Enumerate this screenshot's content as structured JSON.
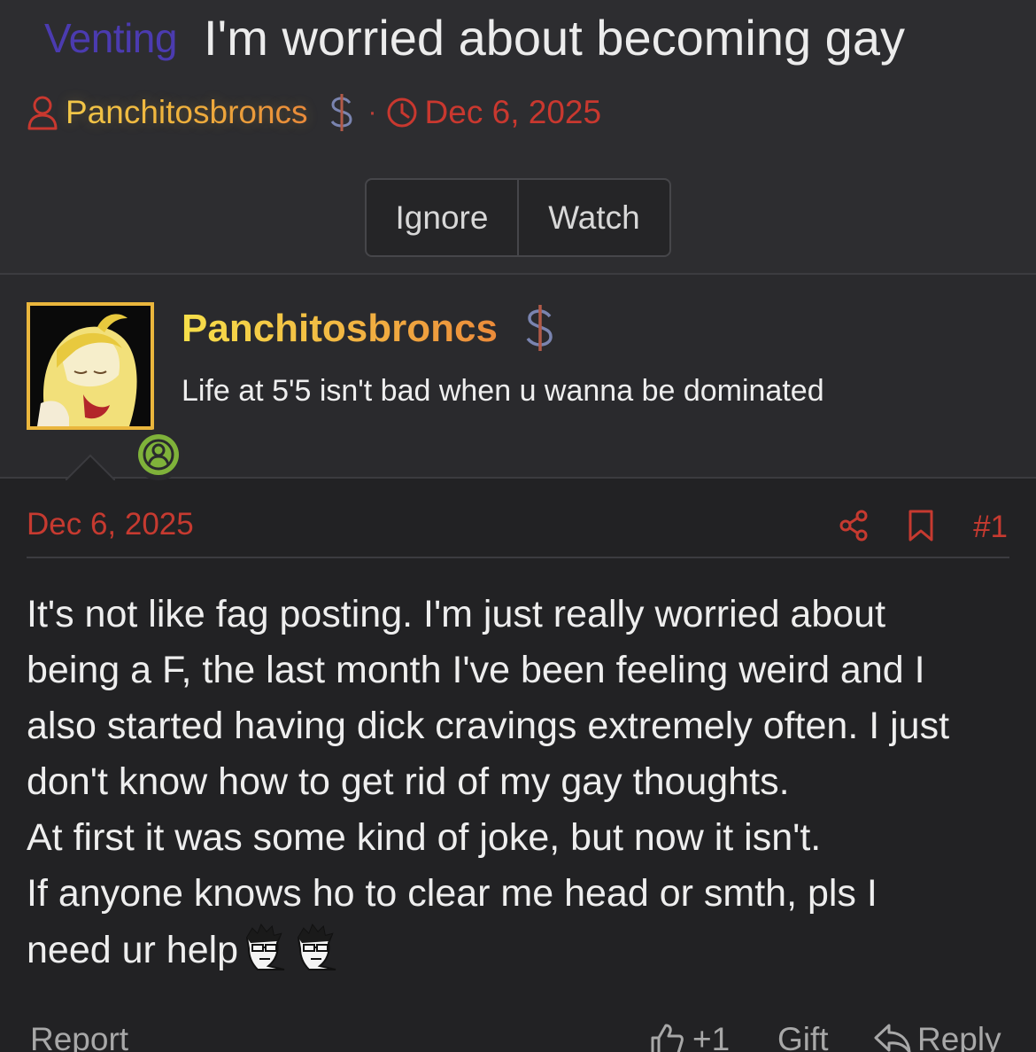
{
  "thread": {
    "prefix": "Venting",
    "title": "I'm worried about becoming gay",
    "author": "Panchitosbroncs",
    "separator": "·",
    "date": "Dec 6, 2025"
  },
  "thread_actions": {
    "ignore_label": "Ignore",
    "watch_label": "Watch"
  },
  "user": {
    "name": "Panchitosbroncs",
    "user_title": "Life at 5'5 isn't bad when u wanna be dominated",
    "status": "online"
  },
  "post": {
    "date": "Dec 6, 2025",
    "number": "#1",
    "lines": [
      "It's not like fag posting. I'm just really worried about",
      "being a F, the last month I've been feeling weird and I",
      "also started having dick cravings extremely often. I just",
      "don't know how to get rid of my gay thoughts.",
      "At first it was some kind of joke, but now it isn't.",
      "If anyone knows ho to clear me head or smth, pls I",
      "need ur help"
    ]
  },
  "post_footer": {
    "report_label": "Report",
    "reaction_count": "+1",
    "gift_label": "Gift",
    "reply_label": "Reply"
  },
  "colors": {
    "background": "#222224",
    "header_bg": "#2d2d30",
    "prefix": "#4b3bb0",
    "date_red": "#c9382f",
    "username_gold": "#f2b843",
    "online_green": "#7fb23a"
  },
  "icons": [
    "user-icon",
    "dollar-icon",
    "clock-icon",
    "online-status-icon",
    "share-icon",
    "bookmark-icon",
    "thumbs-up-icon",
    "reply-icon",
    "emoji-icon"
  ]
}
